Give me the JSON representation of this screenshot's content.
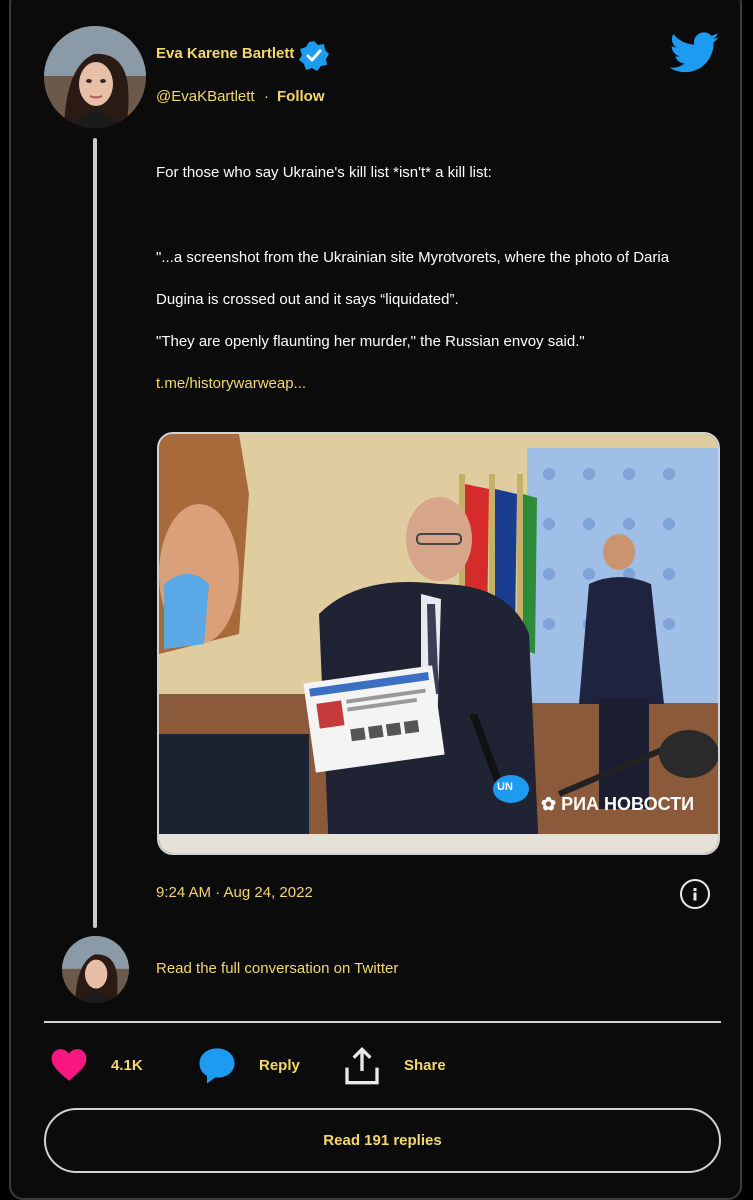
{
  "author": {
    "name": "Eva Karene Bartlett",
    "handle": "@EvaKBartlett",
    "separator": "·",
    "follow_label": "Follow"
  },
  "tweet": {
    "lines": [
      "For those who say Ukraine's kill list *isn't* a kill list:",
      "\"...a screenshot from the Ukrainian site Myrotvorets, where the photo of Daria",
      "Dugina is crossed out and it says “liquidated”.",
      "\"They are openly flaunting her murder,\" the Russian envoy said.\""
    ],
    "link": "t.me/historywarweap...",
    "media_watermark": "РИА НОВОСТИ",
    "mic_label": "UN",
    "timestamp": "9:24 AM · Aug 24, 2022"
  },
  "thread": {
    "read_full": "Read the full conversation on Twitter"
  },
  "actions": {
    "likes": "4.1K",
    "reply_label": "Reply",
    "share_label": "Share",
    "read_replies": "Read 191 replies"
  },
  "colors": {
    "accent": "#f5d76e",
    "twitter_blue": "#1d9bf0",
    "like_pink": "#f91880",
    "background": "#0b0b0b"
  },
  "icons": [
    "verified-badge-icon",
    "twitter-bird-icon",
    "info-icon",
    "heart-icon",
    "reply-bubble-icon",
    "share-icon"
  ]
}
